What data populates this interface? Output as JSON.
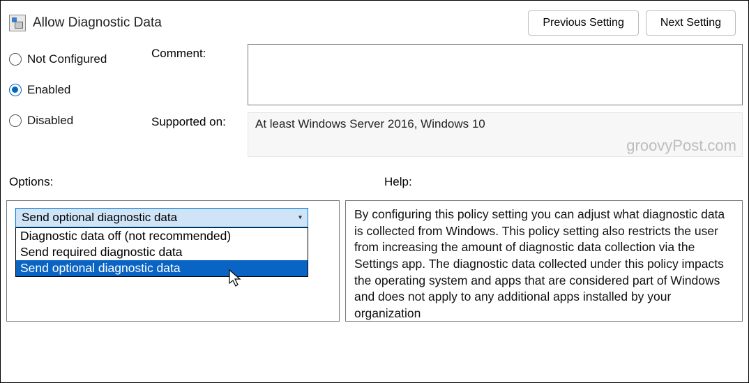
{
  "window": {
    "title": "Allow Diagnostic Data"
  },
  "nav": {
    "prev": "Previous Setting",
    "next": "Next Setting"
  },
  "state": {
    "radios": {
      "not_configured": "Not Configured",
      "enabled": "Enabled",
      "disabled": "Disabled",
      "selected": "enabled"
    }
  },
  "fields": {
    "comment_label": "Comment:",
    "comment_value": "",
    "supported_label": "Supported on:",
    "supported_value": "At least Windows Server 2016, Windows 10"
  },
  "sections": {
    "options": "Options:",
    "help": "Help:"
  },
  "options_dropdown": {
    "selected": "Send optional diagnostic data",
    "items": [
      "Diagnostic data off (not recommended)",
      "Send required diagnostic data",
      "Send optional diagnostic data"
    ],
    "highlight_index": 2
  },
  "help_text": "By configuring this policy setting you can adjust what diagnostic data is collected from Windows. This policy setting also restricts the user from increasing the amount of diagnostic data collection via the Settings app. The diagnostic data collected under this policy impacts the operating system and apps that are considered part of Windows and does not apply to any additional apps installed by your organization",
  "watermark": "groovyPost.com"
}
